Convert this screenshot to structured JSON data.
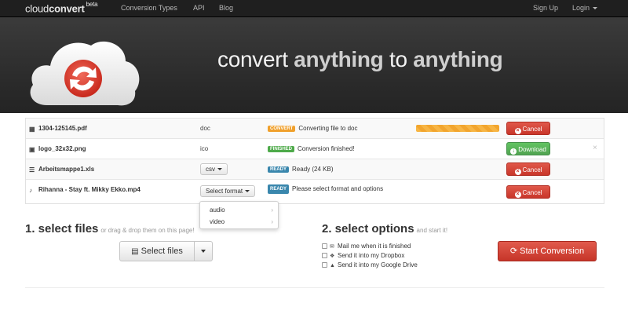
{
  "navbar": {
    "brand_prefix": "cloud",
    "brand_bold": "convert",
    "brand_sup": "beta",
    "links": [
      "Conversion Types",
      "API",
      "Blog"
    ],
    "signup": "Sign Up",
    "login": "Login"
  },
  "hero": {
    "word1": "convert",
    "word2": "anything",
    "word3": "to",
    "word4": "anything"
  },
  "files": [
    {
      "name": "1304-125145.pdf",
      "icon": "pdf-file-icon",
      "type": "doc",
      "badge": "CONVERT",
      "status": "Converting file to doc",
      "progress": 1.0,
      "action": "Cancel"
    },
    {
      "name": "logo_32x32.png",
      "icon": "image-file-icon",
      "type": "ico",
      "badge": "FINISHED",
      "status": "Conversion finished!",
      "action": "Download",
      "dismiss": "×"
    },
    {
      "name": "Arbeitsmappe1.xls",
      "icon": "list-file-icon",
      "type": "csv",
      "badge": "READY",
      "status": "Ready (24 KB)",
      "action": "Cancel"
    },
    {
      "name": "Rihanna - Stay ft. Mikky Ekko.mp4",
      "icon": "audio-file-icon",
      "type": "Select format",
      "badge": "READY",
      "status": "Please select format and options",
      "action": "Cancel"
    }
  ],
  "format_menu": {
    "items": [
      "audio",
      "video"
    ]
  },
  "select_files": {
    "title": "1. select files",
    "subtitle": "or drag & drop them on this page!",
    "button": "Select files"
  },
  "select_options": {
    "title": "2. select options",
    "subtitle": "and start it!",
    "options": [
      "Mail me when it is finished",
      "Send it into my Dropbox",
      "Send it into my Google Drive"
    ],
    "start_button": "Start Conversion"
  },
  "colors": {
    "accent_red": "#c9362a",
    "accent_green": "#51a351",
    "badge_convert": "#f0a02c",
    "badge_finished": "#4eaa4a",
    "badge_ready": "#3a87ad"
  }
}
